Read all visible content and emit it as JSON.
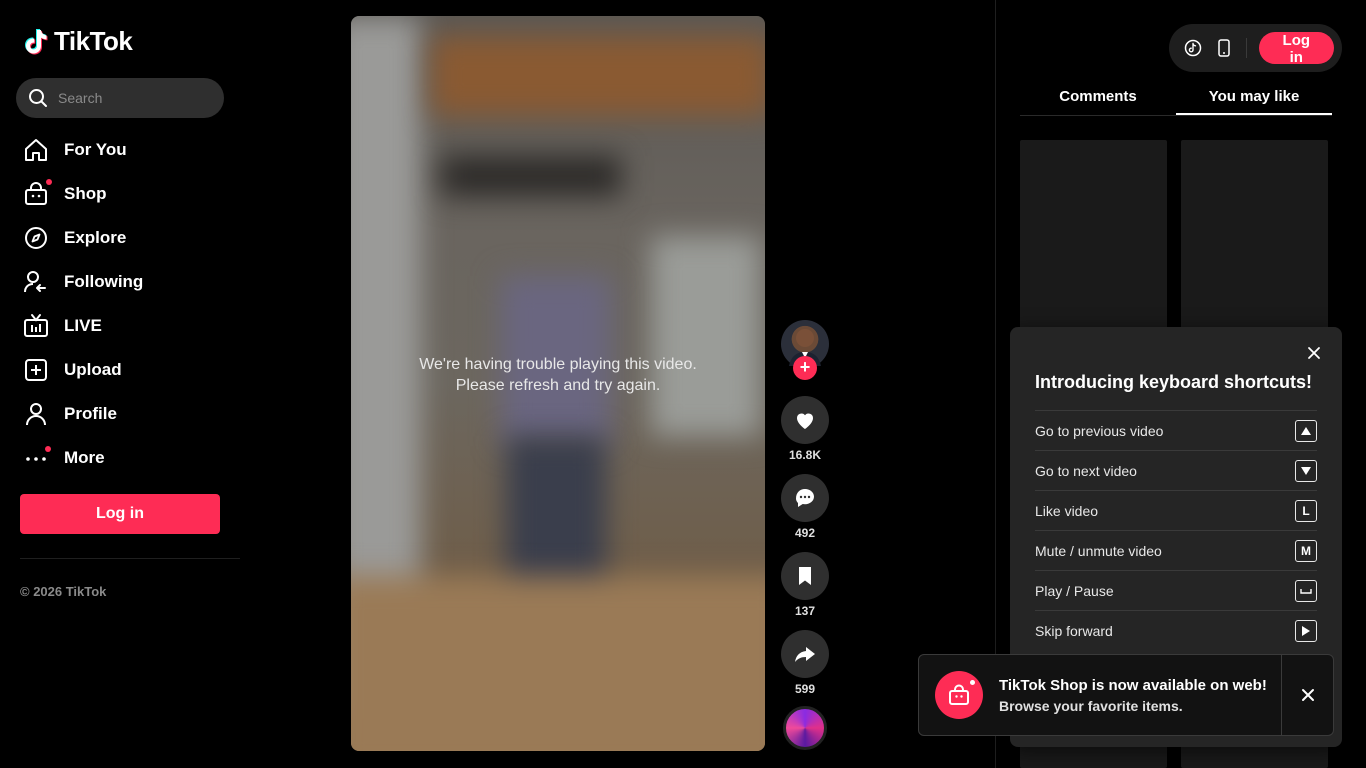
{
  "brand": {
    "name": "TikTok",
    "accent": "#fe2c55"
  },
  "search": {
    "placeholder": "Search"
  },
  "nav": [
    {
      "label": "For You",
      "icon": "home-icon"
    },
    {
      "label": "Shop",
      "icon": "shop-bag-icon"
    },
    {
      "label": "Explore",
      "icon": "compass-icon"
    },
    {
      "label": "Following",
      "icon": "following-icon"
    },
    {
      "label": "LIVE",
      "icon": "live-tv-icon"
    },
    {
      "label": "Upload",
      "icon": "plus-square-icon"
    },
    {
      "label": "Profile",
      "icon": "person-icon"
    },
    {
      "label": "More",
      "icon": "more-dots-icon"
    }
  ],
  "sidebar": {
    "login_label": "Log in",
    "copyright": "© 2026 TikTok"
  },
  "video": {
    "error_line1": "We're having trouble playing this video.",
    "error_line2": "Please refresh and try again."
  },
  "actions": {
    "likes": "16.8K",
    "comments": "492",
    "saves": "137",
    "shares": "599"
  },
  "topbar": {
    "login_label": "Log in"
  },
  "tabs": [
    {
      "label": "Comments"
    },
    {
      "label": "You may like"
    }
  ],
  "shortcuts": {
    "title": "Introducing keyboard shortcuts!",
    "items": [
      {
        "label": "Go to previous video",
        "key": "▲"
      },
      {
        "label": "Go to next video",
        "key": "▼"
      },
      {
        "label": "Like video",
        "key": "L"
      },
      {
        "label": "Mute / unmute video",
        "key": "M"
      },
      {
        "label": "Play / Pause",
        "key": "␣"
      },
      {
        "label": "Skip forward",
        "key": "▶"
      }
    ]
  },
  "toast": {
    "title": "TikTok Shop is now available on web!",
    "subtitle": "Browse your favorite items."
  }
}
